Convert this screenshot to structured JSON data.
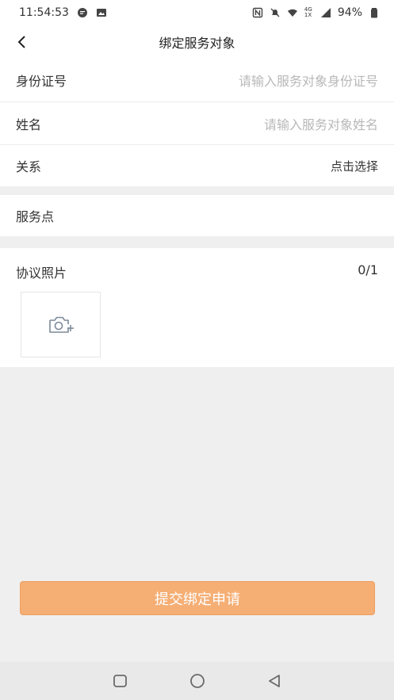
{
  "status_bar": {
    "time": "11:54:53",
    "network": "4G 1X",
    "battery": "94%"
  },
  "header": {
    "title": "绑定服务对象"
  },
  "form": {
    "id_number": {
      "label": "身份证号",
      "placeholder": "请输入服务对象身份证号"
    },
    "name": {
      "label": "姓名",
      "placeholder": "请输入服务对象姓名"
    },
    "relation": {
      "label": "关系",
      "value": "点击选择"
    },
    "service_point": {
      "label": "服务点"
    }
  },
  "photos": {
    "label": "协议照片",
    "count": "0/1"
  },
  "submit_label": "提交绑定申请",
  "colors": {
    "accent": "#f5ae74",
    "placeholder": "#b8b8b8",
    "page_bg": "#efefef"
  }
}
